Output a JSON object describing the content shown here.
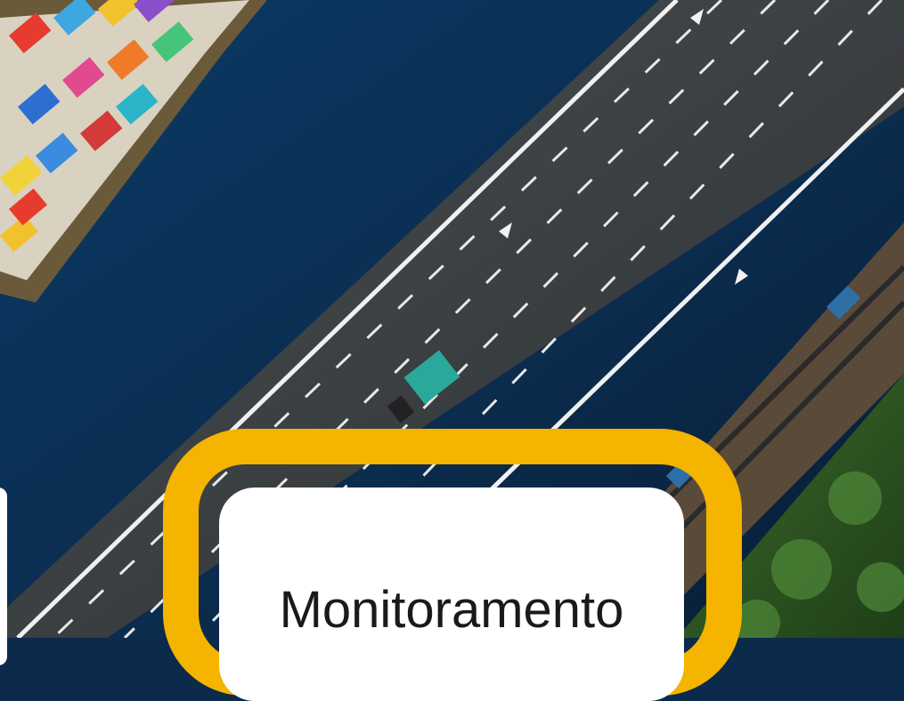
{
  "scene": {
    "description_icons": [
      "cargo-ship-icon",
      "highway-icon",
      "railway-icon",
      "truck-icon",
      "forest-icon"
    ]
  },
  "card": {
    "title": "Monitoramento"
  },
  "colors": {
    "frame": "#f5b400",
    "card": "#ffffff",
    "water": "#0c2a4a",
    "road": "#3a3f42",
    "forest": "#2f5a24"
  }
}
